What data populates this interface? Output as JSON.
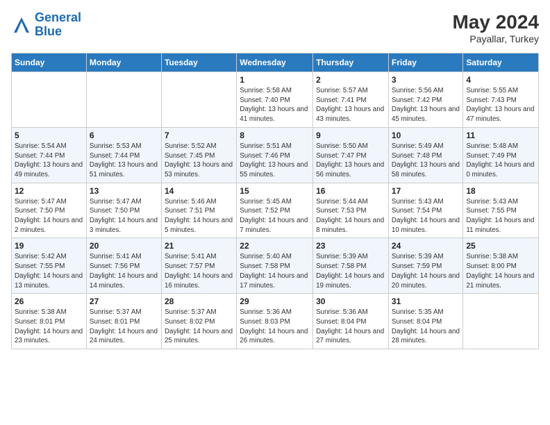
{
  "header": {
    "logo_line1": "General",
    "logo_line2": "Blue",
    "month_year": "May 2024",
    "location": "Payallar, Turkey"
  },
  "weekdays": [
    "Sunday",
    "Monday",
    "Tuesday",
    "Wednesday",
    "Thursday",
    "Friday",
    "Saturday"
  ],
  "weeks": [
    [
      {
        "day": "",
        "info": ""
      },
      {
        "day": "",
        "info": ""
      },
      {
        "day": "",
        "info": ""
      },
      {
        "day": "1",
        "info": "Sunrise: 5:58 AM\nSunset: 7:40 PM\nDaylight: 13 hours and 41 minutes."
      },
      {
        "day": "2",
        "info": "Sunrise: 5:57 AM\nSunset: 7:41 PM\nDaylight: 13 hours and 43 minutes."
      },
      {
        "day": "3",
        "info": "Sunrise: 5:56 AM\nSunset: 7:42 PM\nDaylight: 13 hours and 45 minutes."
      },
      {
        "day": "4",
        "info": "Sunrise: 5:55 AM\nSunset: 7:43 PM\nDaylight: 13 hours and 47 minutes."
      }
    ],
    [
      {
        "day": "5",
        "info": "Sunrise: 5:54 AM\nSunset: 7:44 PM\nDaylight: 13 hours and 49 minutes."
      },
      {
        "day": "6",
        "info": "Sunrise: 5:53 AM\nSunset: 7:44 PM\nDaylight: 13 hours and 51 minutes."
      },
      {
        "day": "7",
        "info": "Sunrise: 5:52 AM\nSunset: 7:45 PM\nDaylight: 13 hours and 53 minutes."
      },
      {
        "day": "8",
        "info": "Sunrise: 5:51 AM\nSunset: 7:46 PM\nDaylight: 13 hours and 55 minutes."
      },
      {
        "day": "9",
        "info": "Sunrise: 5:50 AM\nSunset: 7:47 PM\nDaylight: 13 hours and 56 minutes."
      },
      {
        "day": "10",
        "info": "Sunrise: 5:49 AM\nSunset: 7:48 PM\nDaylight: 13 hours and 58 minutes."
      },
      {
        "day": "11",
        "info": "Sunrise: 5:48 AM\nSunset: 7:49 PM\nDaylight: 14 hours and 0 minutes."
      }
    ],
    [
      {
        "day": "12",
        "info": "Sunrise: 5:47 AM\nSunset: 7:50 PM\nDaylight: 14 hours and 2 minutes."
      },
      {
        "day": "13",
        "info": "Sunrise: 5:47 AM\nSunset: 7:50 PM\nDaylight: 14 hours and 3 minutes."
      },
      {
        "day": "14",
        "info": "Sunrise: 5:46 AM\nSunset: 7:51 PM\nDaylight: 14 hours and 5 minutes."
      },
      {
        "day": "15",
        "info": "Sunrise: 5:45 AM\nSunset: 7:52 PM\nDaylight: 14 hours and 7 minutes."
      },
      {
        "day": "16",
        "info": "Sunrise: 5:44 AM\nSunset: 7:53 PM\nDaylight: 14 hours and 8 minutes."
      },
      {
        "day": "17",
        "info": "Sunrise: 5:43 AM\nSunset: 7:54 PM\nDaylight: 14 hours and 10 minutes."
      },
      {
        "day": "18",
        "info": "Sunrise: 5:43 AM\nSunset: 7:55 PM\nDaylight: 14 hours and 11 minutes."
      }
    ],
    [
      {
        "day": "19",
        "info": "Sunrise: 5:42 AM\nSunset: 7:55 PM\nDaylight: 14 hours and 13 minutes."
      },
      {
        "day": "20",
        "info": "Sunrise: 5:41 AM\nSunset: 7:56 PM\nDaylight: 14 hours and 14 minutes."
      },
      {
        "day": "21",
        "info": "Sunrise: 5:41 AM\nSunset: 7:57 PM\nDaylight: 14 hours and 16 minutes."
      },
      {
        "day": "22",
        "info": "Sunrise: 5:40 AM\nSunset: 7:58 PM\nDaylight: 14 hours and 17 minutes."
      },
      {
        "day": "23",
        "info": "Sunrise: 5:39 AM\nSunset: 7:58 PM\nDaylight: 14 hours and 19 minutes."
      },
      {
        "day": "24",
        "info": "Sunrise: 5:39 AM\nSunset: 7:59 PM\nDaylight: 14 hours and 20 minutes."
      },
      {
        "day": "25",
        "info": "Sunrise: 5:38 AM\nSunset: 8:00 PM\nDaylight: 14 hours and 21 minutes."
      }
    ],
    [
      {
        "day": "26",
        "info": "Sunrise: 5:38 AM\nSunset: 8:01 PM\nDaylight: 14 hours and 23 minutes."
      },
      {
        "day": "27",
        "info": "Sunrise: 5:37 AM\nSunset: 8:01 PM\nDaylight: 14 hours and 24 minutes."
      },
      {
        "day": "28",
        "info": "Sunrise: 5:37 AM\nSunset: 8:02 PM\nDaylight: 14 hours and 25 minutes."
      },
      {
        "day": "29",
        "info": "Sunrise: 5:36 AM\nSunset: 8:03 PM\nDaylight: 14 hours and 26 minutes."
      },
      {
        "day": "30",
        "info": "Sunrise: 5:36 AM\nSunset: 8:04 PM\nDaylight: 14 hours and 27 minutes."
      },
      {
        "day": "31",
        "info": "Sunrise: 5:35 AM\nSunset: 8:04 PM\nDaylight: 14 hours and 28 minutes."
      },
      {
        "day": "",
        "info": ""
      }
    ]
  ]
}
